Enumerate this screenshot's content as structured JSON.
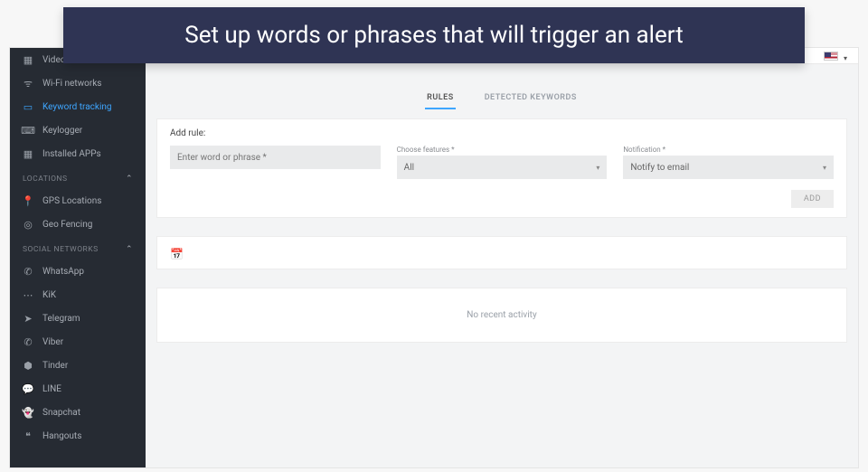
{
  "callout": "Set up words or phrases that will trigger an alert",
  "sidebar": {
    "items_top": [
      {
        "label": "Video",
        "icon": "▦",
        "name": "sidebar-item-video"
      },
      {
        "label": "Wi-Fi networks",
        "icon": "ᯤ",
        "name": "sidebar-item-wifi"
      },
      {
        "label": "Keyword tracking",
        "icon": "▭",
        "name": "sidebar-item-keyword-tracking",
        "active": true
      },
      {
        "label": "Keylogger",
        "icon": "⌨",
        "name": "sidebar-item-keylogger"
      },
      {
        "label": "Installed APPs",
        "icon": "▦",
        "name": "sidebar-item-installed-apps"
      }
    ],
    "section_locations": "LOCATIONS",
    "items_locations": [
      {
        "label": "GPS Locations",
        "icon": "📍",
        "name": "sidebar-item-gps"
      },
      {
        "label": "Geo Fencing",
        "icon": "◎",
        "name": "sidebar-item-geofencing"
      }
    ],
    "section_social": "SOCIAL NETWORKS",
    "items_social": [
      {
        "label": "WhatsApp",
        "icon": "✆",
        "name": "sidebar-item-whatsapp"
      },
      {
        "label": "KiK",
        "icon": "⋯",
        "name": "sidebar-item-kik"
      },
      {
        "label": "Telegram",
        "icon": "➤",
        "name": "sidebar-item-telegram"
      },
      {
        "label": "Viber",
        "icon": "✆",
        "name": "sidebar-item-viber"
      },
      {
        "label": "Tinder",
        "icon": "⬢",
        "name": "sidebar-item-tinder"
      },
      {
        "label": "LINE",
        "icon": "💬",
        "name": "sidebar-item-line"
      },
      {
        "label": "Snapchat",
        "icon": "👻",
        "name": "sidebar-item-snapchat"
      },
      {
        "label": "Hangouts",
        "icon": "❝",
        "name": "sidebar-item-hangouts"
      }
    ]
  },
  "tabs": {
    "rules": "RULES",
    "detected": "DETECTED KEYWORDS"
  },
  "form": {
    "title": "Add rule:",
    "input_placeholder": "Enter word or phrase *",
    "features_label": "Choose features *",
    "features_value": "All",
    "notification_label": "Notification *",
    "notification_value": "Notify to email",
    "add_button": "ADD"
  },
  "activity": {
    "empty": "No recent activity"
  }
}
